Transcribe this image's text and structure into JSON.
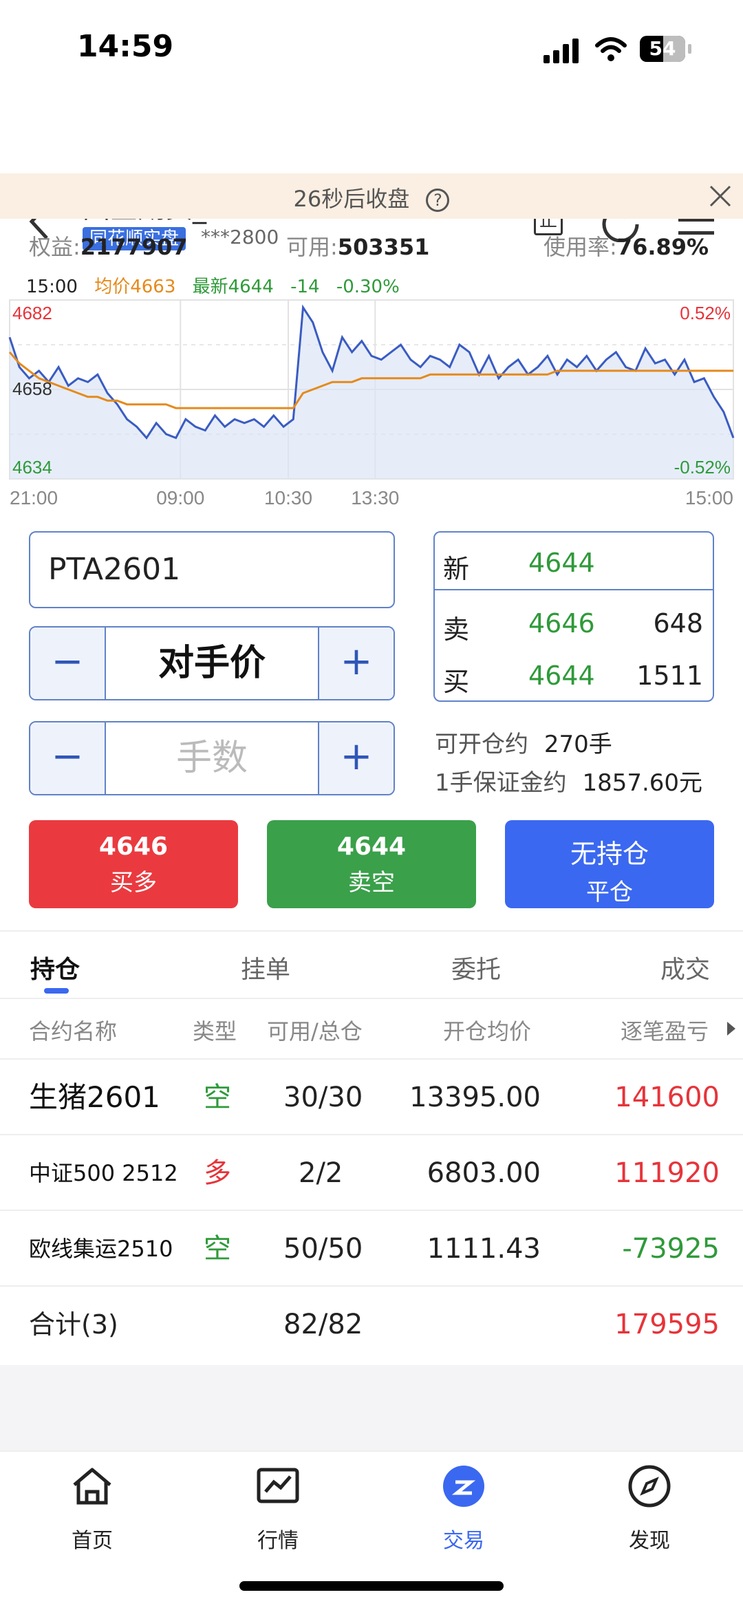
{
  "status": {
    "time": "14:59",
    "battery": "54"
  },
  "header": {
    "title": "国金期货_CTP",
    "tag": "同花顺实盘",
    "account": "***2800"
  },
  "banner": {
    "text": "26秒后收盘"
  },
  "account_stats": {
    "equity_label": "权益:",
    "equity": "2177907",
    "available_label": "可用:",
    "available": "503351",
    "usage_label": "使用率:",
    "usage": "76.89%"
  },
  "chart_info": {
    "time": "15:00",
    "avg": "均价4663",
    "last": "最新4644",
    "change": "-14",
    "pct": "-0.30%"
  },
  "chart_data": {
    "type": "line",
    "series": [
      {
        "name": "最新",
        "values": [
          4672,
          4664,
          4661,
          4663,
          4660,
          4664,
          4659,
          4661,
          4660,
          4662,
          4657,
          4654,
          4650,
          4648,
          4645,
          4649,
          4646,
          4645,
          4650,
          4648,
          4647,
          4651,
          4648,
          4650,
          4649,
          4650,
          4648,
          4651,
          4648,
          4650,
          4680,
          4676,
          4668,
          4663,
          4672,
          4668,
          4671,
          4667,
          4666,
          4668,
          4670,
          4666,
          4664,
          4667,
          4666,
          4664,
          4670,
          4668,
          4662,
          4667,
          4661,
          4664,
          4666,
          4662,
          4664,
          4667,
          4662,
          4666,
          4664,
          4667,
          4663,
          4666,
          4668,
          4664,
          4663,
          4669,
          4665,
          4666,
          4662,
          4666,
          4660,
          4661,
          4656,
          4652,
          4645
        ]
      },
      {
        "name": "均价",
        "values": [
          4668,
          4665,
          4663,
          4661,
          4660,
          4659,
          4658,
          4657,
          4656,
          4656,
          4655,
          4655,
          4654,
          4654,
          4654,
          4654,
          4654,
          4653,
          4653,
          4653,
          4653,
          4653,
          4653,
          4653,
          4653,
          4653,
          4653,
          4653,
          4653,
          4653,
          4657,
          4658,
          4659,
          4660,
          4660,
          4660,
          4661,
          4661,
          4661,
          4661,
          4661,
          4661,
          4661,
          4662,
          4662,
          4662,
          4662,
          4662,
          4662,
          4662,
          4662,
          4662,
          4662,
          4662,
          4662,
          4662,
          4663,
          4663,
          4663,
          4663,
          4663,
          4663,
          4663,
          4663,
          4663,
          4663,
          4663,
          4663,
          4663,
          4663,
          4663,
          4663,
          4663,
          4663,
          4663
        ]
      }
    ],
    "ylim": [
      4634,
      4682
    ],
    "y_ticks": [
      "4682",
      "4658",
      "4634"
    ],
    "right_ticks": [
      "0.52%",
      "-0.52%"
    ],
    "x_ticks": [
      "21:00",
      "09:00",
      "10:30",
      "13:30",
      "15:00"
    ],
    "colors": {
      "last": "#3a5cc2",
      "avg": "#e58a1c",
      "fill": "#dbe6f7"
    }
  },
  "order": {
    "symbol": "PTA2601",
    "price_mode": "对手价",
    "qty_placeholder": "手数",
    "minus": "−",
    "plus": "+"
  },
  "quote": {
    "new_label": "新",
    "new_price": "4644",
    "sell_label": "卖",
    "sell_price": "4646",
    "sell_vol": "648",
    "buy_label": "买",
    "buy_price": "4644",
    "buy_vol": "1511"
  },
  "open_info": {
    "can_open_label": "可开仓约",
    "can_open": "270手",
    "margin_label": "1手保证金约",
    "margin": "1857.60元"
  },
  "buttons": {
    "buy": {
      "price": "4646",
      "label": "买多",
      "color": "#ea3a3f"
    },
    "sell": {
      "price": "4644",
      "label": "卖空",
      "color": "#3aa04a"
    },
    "close": {
      "price": "无持仓",
      "label": "平仓",
      "color": "#3b68f0"
    }
  },
  "tabs": [
    "持仓",
    "挂单",
    "委托",
    "成交"
  ],
  "table": {
    "headers": [
      "合约名称",
      "类型",
      "可用/总仓",
      "开仓均价",
      "逐笔盈亏"
    ],
    "rows": [
      {
        "name": "生猪2601",
        "type": "空",
        "qty": "30/30",
        "avg": "13395.00",
        "pnl": "141600"
      },
      {
        "name": "中证500 2512",
        "type": "多",
        "qty": "2/2",
        "avg": "6803.00",
        "pnl": "111920"
      },
      {
        "name": "欧线集运2510",
        "type": "空",
        "qty": "50/50",
        "avg": "1111.43",
        "pnl": "-73925"
      }
    ],
    "total": {
      "name": "合计(3)",
      "qty": "82/82",
      "pnl": "179595"
    }
  },
  "nav": [
    {
      "label": "首页",
      "icon": "home-icon"
    },
    {
      "label": "行情",
      "icon": "chart-icon"
    },
    {
      "label": "交易",
      "icon": "trade-icon"
    },
    {
      "label": "发现",
      "icon": "compass-icon"
    }
  ]
}
